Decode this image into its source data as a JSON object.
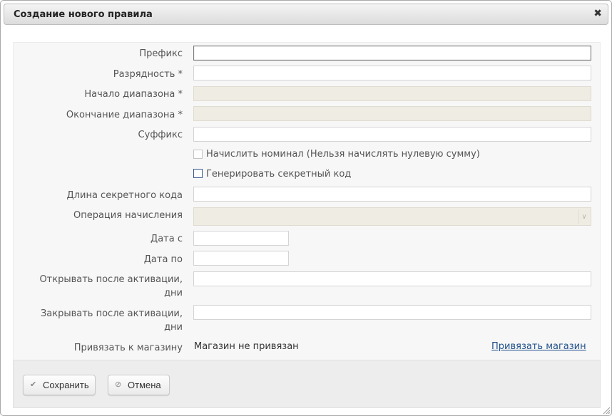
{
  "dialog": {
    "title": "Создание нового правила",
    "close_symbol": "✖"
  },
  "fields": {
    "prefix": {
      "label": "Префикс",
      "value": ""
    },
    "digits": {
      "label": "Разрядность *",
      "value": ""
    },
    "range_start": {
      "label": "Начало диапазона *",
      "value": ""
    },
    "range_end": {
      "label": "Окончание диапазона *",
      "value": ""
    },
    "suffix": {
      "label": "Суффикс",
      "value": ""
    },
    "accrue_nominal": {
      "label": "Начислить номинал (Нельзя начислять нулевую сумму)",
      "checked": false
    },
    "generate_secret": {
      "label": "Генерировать секретный код",
      "checked": false
    },
    "secret_length": {
      "label": "Длина секретного кода",
      "value": ""
    },
    "accrual_operation": {
      "label": "Операция начисления",
      "selected": ""
    },
    "date_from": {
      "label": "Дата с",
      "value": ""
    },
    "date_to": {
      "label": "Дата по",
      "value": ""
    },
    "open_after_line1": "Открывать после активации,",
    "open_after_line2": "дни",
    "open_after_value": "",
    "close_after_line1": "Закрывать после активации,",
    "close_after_line2": "дни",
    "close_after_value": "",
    "store": {
      "label": "Привязать к магазину",
      "value": "Магазин не привязан",
      "link": "Привязать магазин"
    }
  },
  "buttons": {
    "save": "Сохранить",
    "cancel": "Отмена"
  },
  "colors": {
    "disabled_field": "#efede3",
    "link": "#1f4f8a",
    "checkbox_active": "#39588f"
  }
}
